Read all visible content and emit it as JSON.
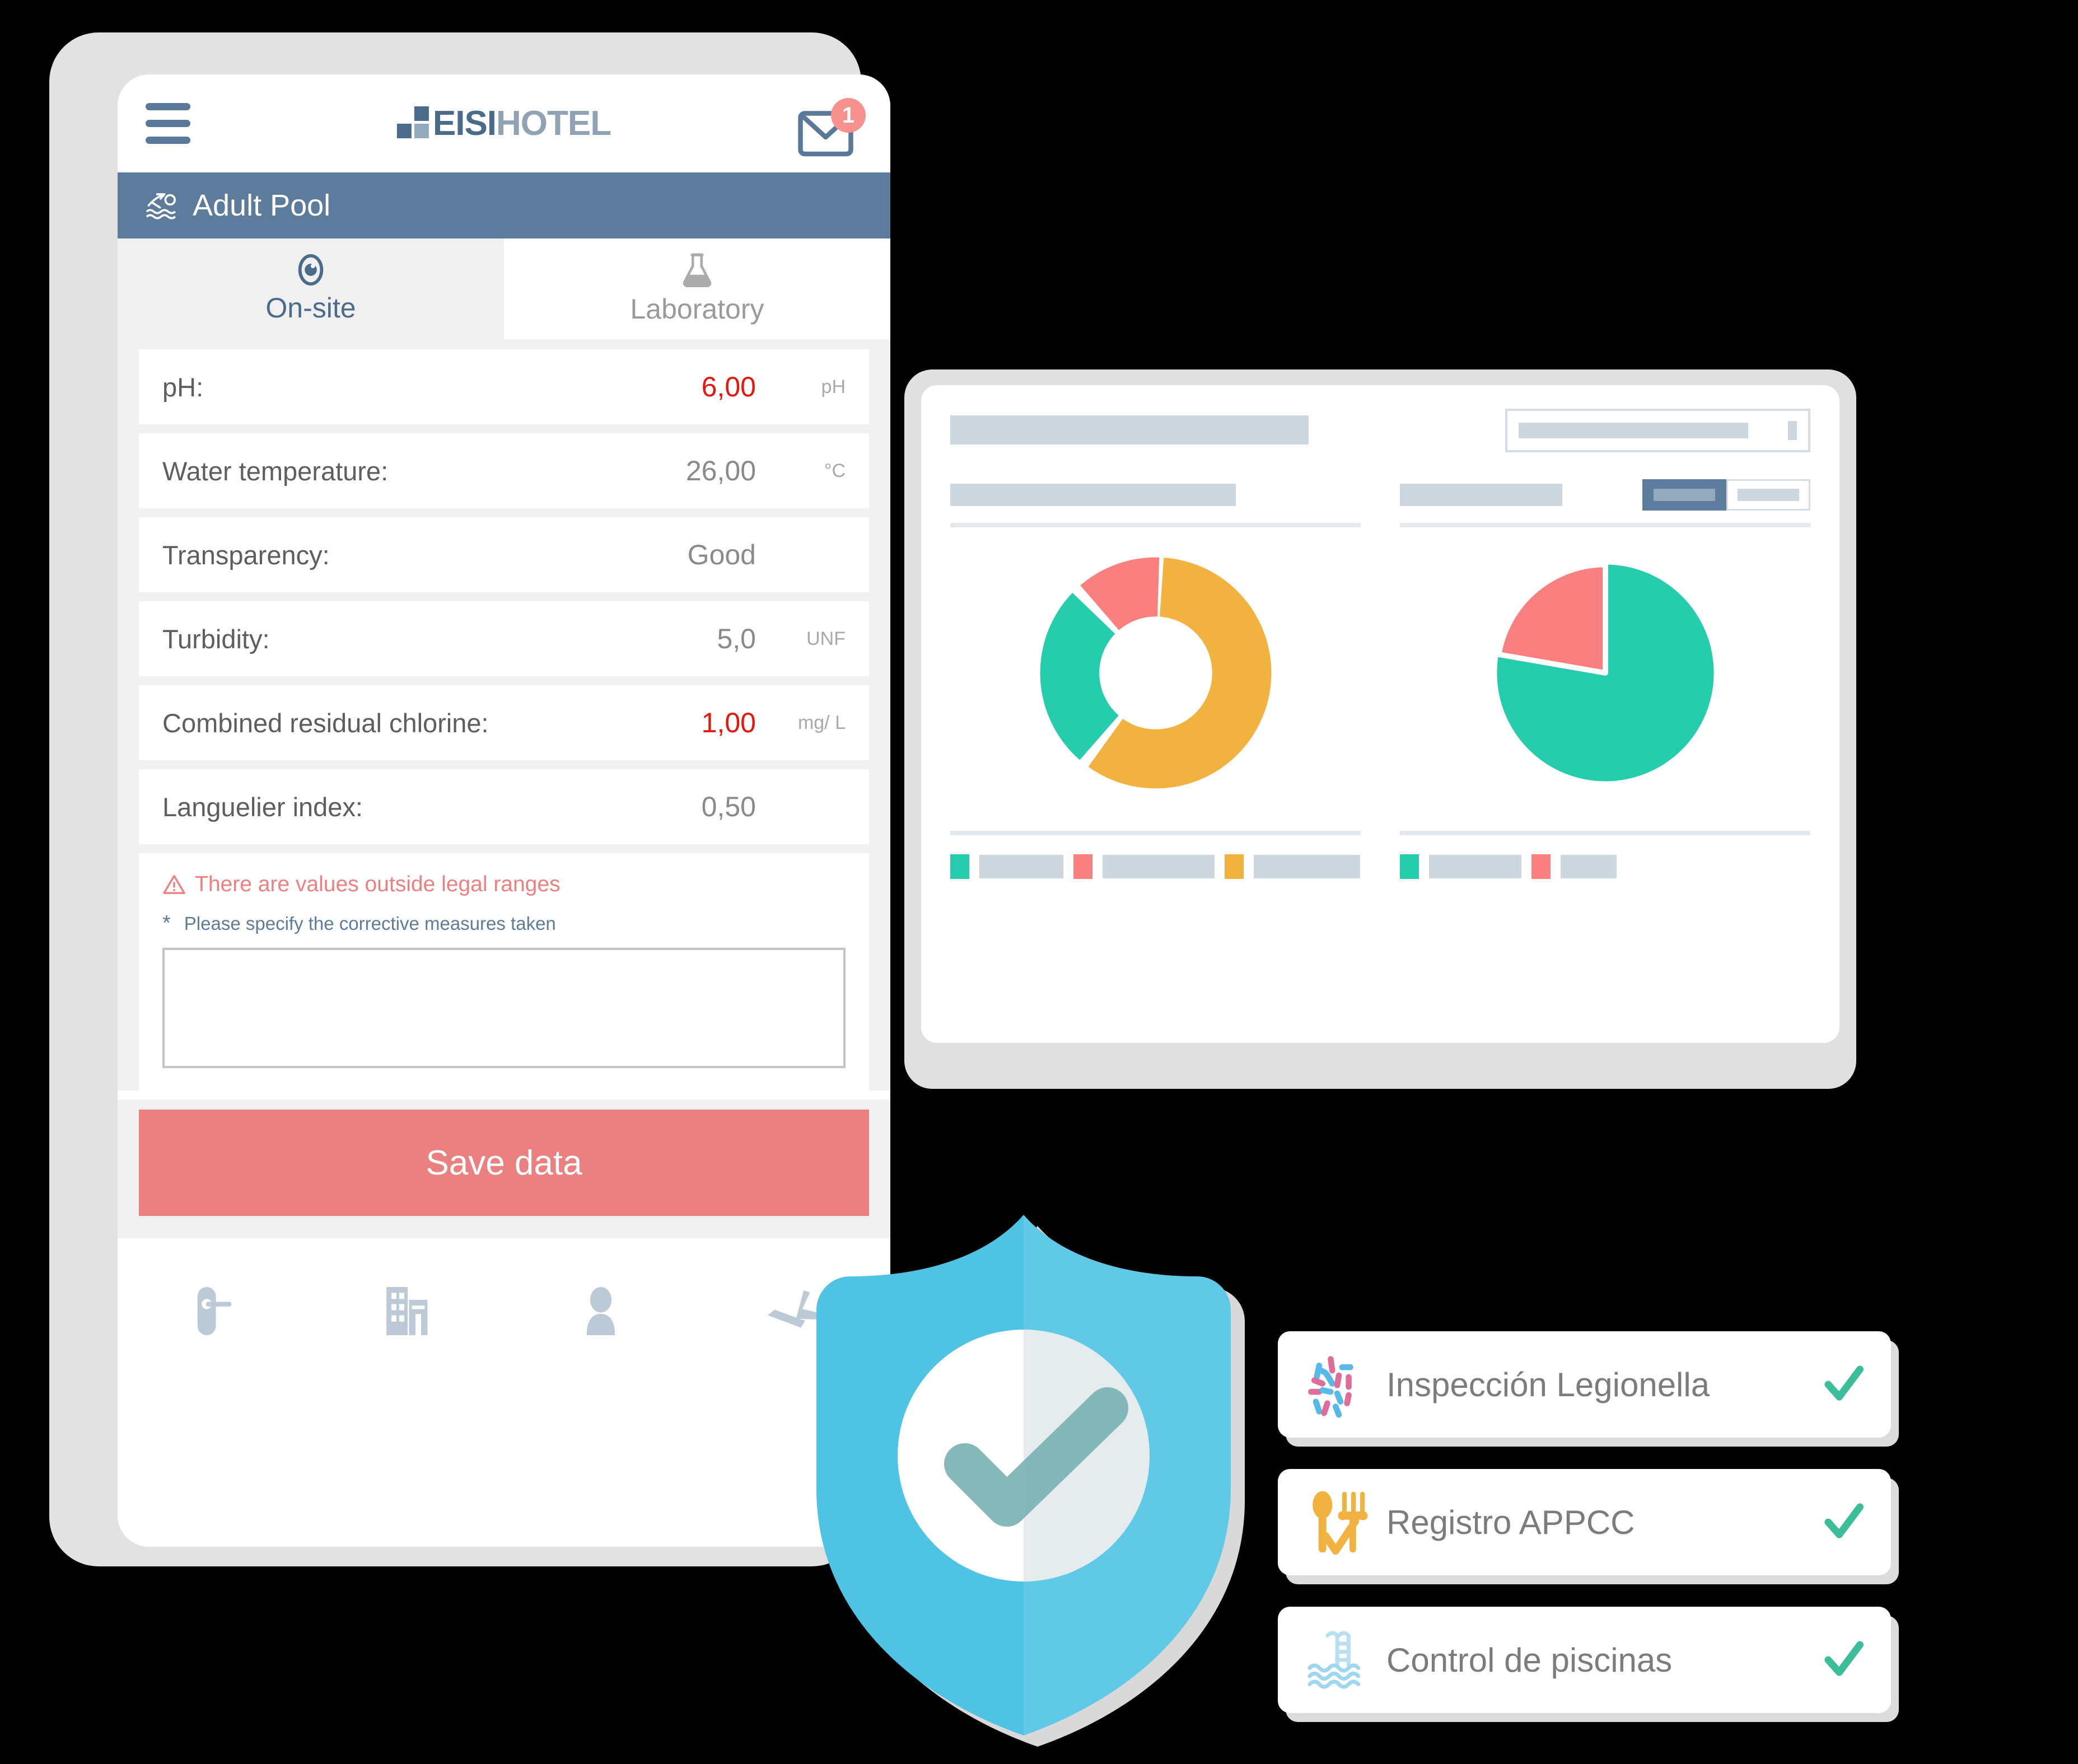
{
  "phone": {
    "header": {
      "menu_icon": "hamburger-icon",
      "logo_primary": "EISI",
      "logo_secondary": "HOTEL",
      "mail_icon": "mail-icon",
      "mail_badge_count": "1"
    },
    "pool_bar": {
      "icon": "swimmer-icon",
      "title": "Adult Pool"
    },
    "tabs": [
      {
        "label": "On-site",
        "icon": "eye-icon",
        "active": true
      },
      {
        "label": "Laboratory",
        "icon": "flask-icon",
        "active": false
      }
    ],
    "fields": [
      {
        "label": "pH:",
        "value": "6,00",
        "unit": "pH",
        "alert": true
      },
      {
        "label": "Water temperature:",
        "value": "26,00",
        "unit": "°C",
        "alert": false
      },
      {
        "label": "Transparency:",
        "value": "Good",
        "unit": "",
        "alert": false
      },
      {
        "label": "Turbidity:",
        "value": "5,0",
        "unit": "UNF",
        "alert": false
      },
      {
        "label": "Combined residual chlorine:",
        "value": "1,00",
        "unit": "mg/ L",
        "alert": true
      },
      {
        "label": "Languelier index:",
        "value": "0,50",
        "unit": "",
        "alert": false
      }
    ],
    "warning": {
      "icon": "warning-triangle-icon",
      "text": "There are values outside legal ranges",
      "required_marker": "*",
      "required_label": "Please specify the corrective measures taken",
      "textarea_value": "",
      "textarea_placeholder": ""
    },
    "save_button_label": "Save data",
    "bottom_nav": [
      {
        "icon": "door-handle-icon"
      },
      {
        "icon": "building-icon"
      },
      {
        "icon": "person-icon"
      },
      {
        "icon": "airplane-takeoff-icon"
      }
    ]
  },
  "tablet": {
    "search_placeholder": "",
    "search_value": "",
    "toggle_left_label": "",
    "toggle_right_label": "",
    "panels": [
      {
        "name": "donut-panel",
        "legend_count": 3
      },
      {
        "name": "pie-panel",
        "legend_count": 2
      }
    ]
  },
  "chart_data": [
    {
      "type": "pie",
      "title": "",
      "variant": "donut",
      "categories": [
        "series-a",
        "series-b",
        "series-c"
      ],
      "values": [
        60,
        27,
        13
      ],
      "colors": [
        "#f2b240",
        "#25cdad",
        "#fa8080"
      ],
      "legend": [
        "",
        "",
        ""
      ],
      "legend_position": "bottom"
    },
    {
      "type": "pie",
      "title": "",
      "variant": "pie",
      "categories": [
        "series-a",
        "series-b"
      ],
      "values": [
        78,
        22
      ],
      "colors": [
        "#25cdad",
        "#fa8080"
      ],
      "legend": [
        "",
        ""
      ],
      "legend_position": "bottom"
    }
  ],
  "shield": {
    "icon": "shield-check-icon",
    "color": "#4ec3e4"
  },
  "badges": [
    {
      "icon": "bacteria-icon",
      "label": "Inspección Legionella",
      "check": "✔"
    },
    {
      "icon": "cutlery-check-icon",
      "label": "Registro APPCC",
      "check": "✔"
    },
    {
      "icon": "pool-ladder-icon",
      "label": "Control de piscinas",
      "check": "✔"
    }
  ],
  "colors": {
    "brand_blue": "#5d7b9b",
    "logo_dark": "#4a6b8a",
    "logo_light": "#8fa3b5",
    "alert_red": "#e8160c",
    "coral": "#ea8080",
    "teal": "#25cdad",
    "amber": "#f2b240",
    "shield_blue": "#4ec3e4"
  }
}
